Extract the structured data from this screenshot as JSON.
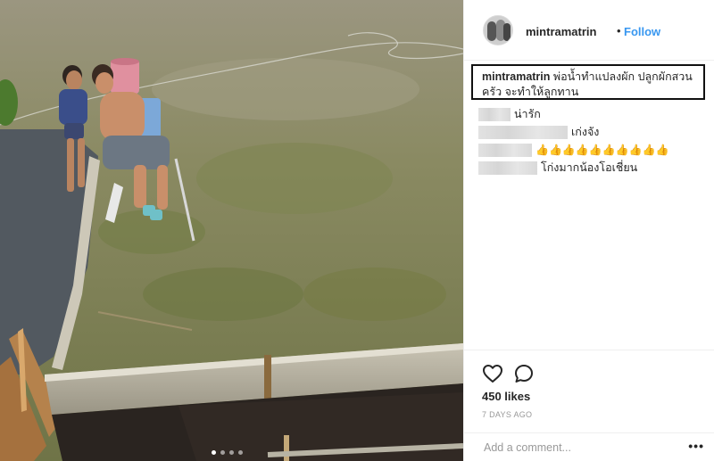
{
  "post": {
    "username": "mintramatrin",
    "separator": "•",
    "follow_label": "Follow",
    "caption_username": "mintramatrin",
    "caption_text": "พ่อน้ำทำแปลงผัก ปลูกผักสวนครัว จะทำให้ลูกทาน",
    "likes": "450 likes",
    "time": "7 DAYS AGO",
    "comment_placeholder": "Add a comment...",
    "more_label": "•••"
  },
  "comments": [
    {
      "text": "น่ารัก"
    },
    {
      "text": "เก่งจัง"
    },
    {
      "text": "👍👍👍👍👍👍👍👍👍👍"
    },
    {
      "text": "โก่งมากน้องโอเชี่ยน"
    }
  ],
  "icons": {
    "like": "heart-icon",
    "comment": "comment-bubble-icon"
  },
  "colors": {
    "accent": "#3897f0",
    "text": "#262626",
    "muted": "#999999"
  },
  "carousel": {
    "count": 4,
    "active": 1
  }
}
